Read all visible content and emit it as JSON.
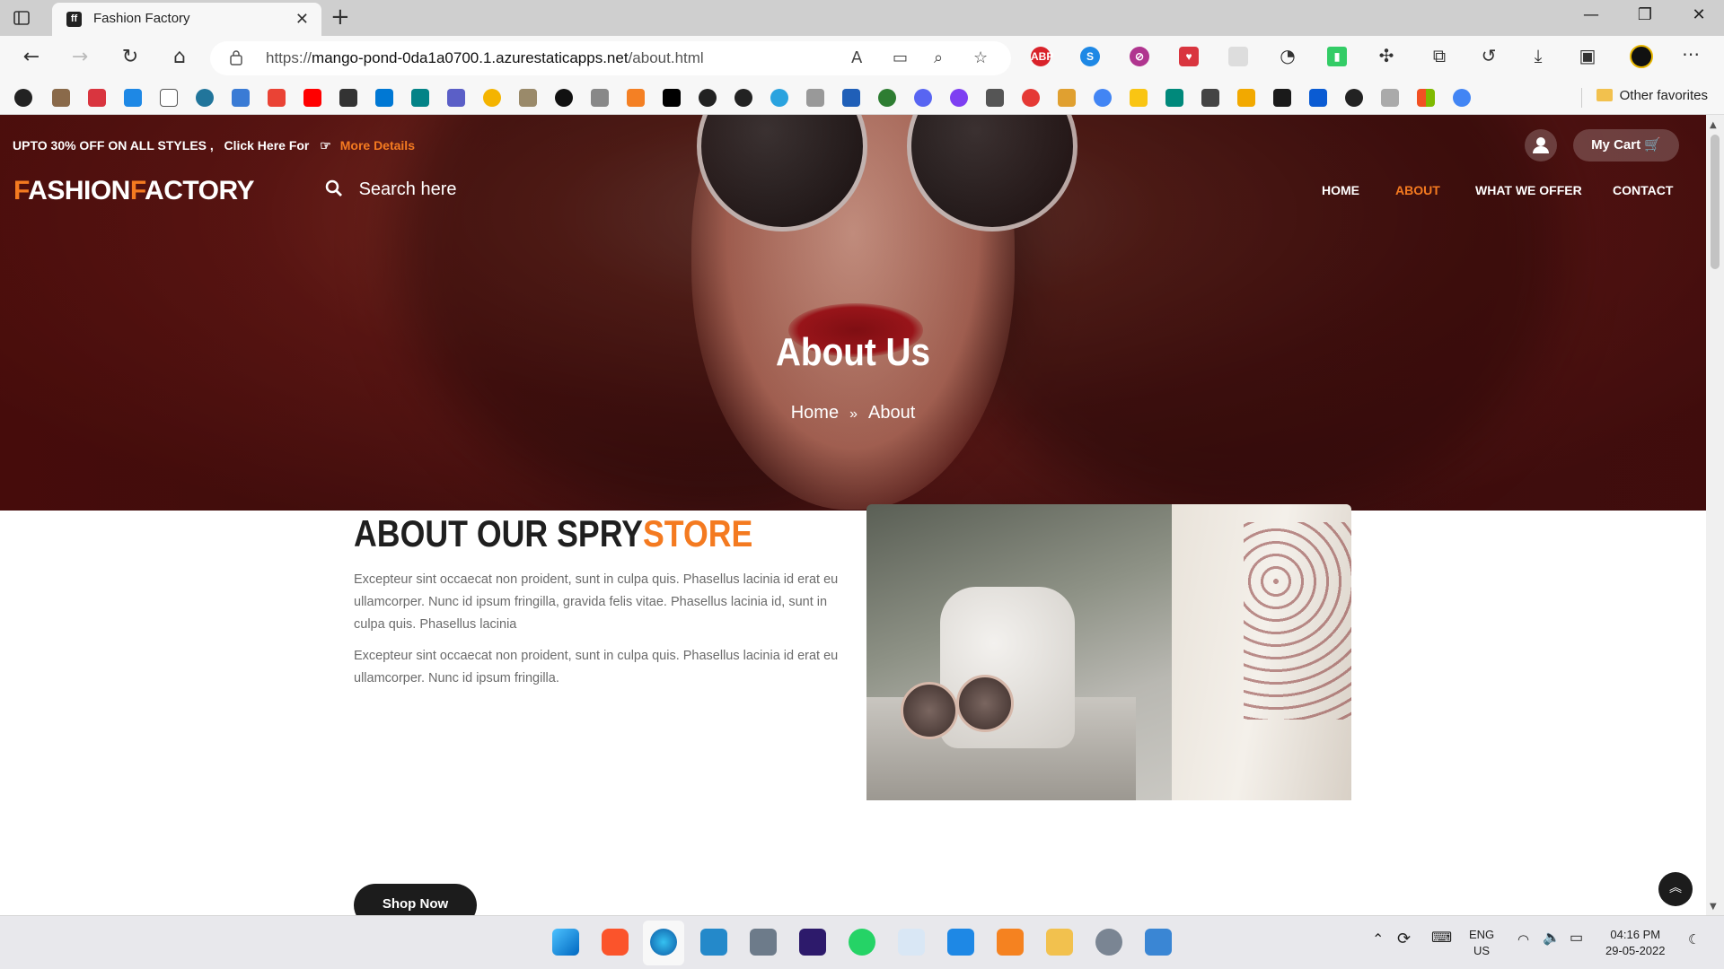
{
  "browser": {
    "tab_title": "Fashion Factory",
    "tab_favicon": "ff",
    "url_prefix": "https://",
    "url_host": "mango-pond-0da1a0700.1.azurestaticapps.net",
    "url_path": "/about.html",
    "other_favorites": "Other favorites"
  },
  "page": {
    "promo_text": "UPTO 30% OFF ON ALL STYLES ,",
    "promo_cta": "Click Here For",
    "promo_link": "More Details",
    "cart_label": "My Cart",
    "logo_part1": "F",
    "logo_part2": "ASHION",
    "logo_part3": "F",
    "logo_part4": "ACTORY",
    "search_placeholder": "Search here",
    "nav": [
      "HOME",
      "ABOUT",
      "WHAT WE OFFER",
      "CONTACT"
    ],
    "active_nav": "ABOUT",
    "hero_title": "About Us",
    "breadcrumb": [
      "Home",
      "About"
    ],
    "about_heading_dark": "ABOUT OUR SPRY",
    "about_heading_accent": "STORE",
    "paragraph1": "Excepteur sint occaecat non proident, sunt in culpa quis. Phasellus lacinia id erat eu ullamcorper. Nunc id ipsum fringilla, gravida felis vitae. Phasellus lacinia id, sunt in culpa quis. Phasellus lacinia",
    "paragraph2": "Excepteur sint occaecat non proident, sunt in culpa quis. Phasellus lacinia id erat eu ullamcorper. Nunc id ipsum fringilla.",
    "shop_button": "Shop Now",
    "accent_color": "#f47a20"
  },
  "taskbar": {
    "lang_line1": "ENG",
    "lang_line2": "US",
    "time": "04:16 PM",
    "date": "29-05-2022"
  }
}
